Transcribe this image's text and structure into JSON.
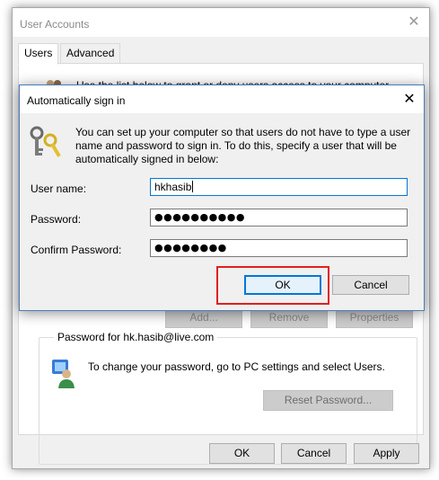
{
  "user_accounts": {
    "title": "User Accounts",
    "close_glyph": "✕",
    "tabs": [
      {
        "label": "Users"
      },
      {
        "label": "Advanced"
      }
    ],
    "description": "Use the list below to grant or deny users access to your computer,",
    "background_buttons": [
      "Add...",
      "Remove",
      "Properties"
    ],
    "password_group": {
      "legend": "Password for hk.hasib@live.com",
      "text": "To change your password, go to PC settings and select Users.",
      "reset_label": "Reset Password..."
    },
    "buttons": {
      "ok": "OK",
      "cancel": "Cancel",
      "apply": "Apply"
    }
  },
  "auto_signin": {
    "title": "Automatically sign in",
    "close_glyph": "✕",
    "description": "You can set up your computer so that users do not have to type a user name and password to sign in. To do this, specify a user that will be automatically signed in below:",
    "fields": {
      "username": {
        "label": "User name:",
        "value": "hkhasib"
      },
      "password": {
        "label": "Password:",
        "value": "●●●●●●●●●●"
      },
      "confirm": {
        "label": "Confirm Password:",
        "value": "●●●●●●●●"
      }
    },
    "ok_label": "OK",
    "cancel_label": "Cancel"
  },
  "icons": {
    "users": "users-icon",
    "keys": "keys-icon",
    "password_user": "user-password-icon"
  },
  "colors": {
    "focus_blue": "#0078d7",
    "highlight_red": "#e02020",
    "dialog_bg": "#f0f0f0"
  }
}
